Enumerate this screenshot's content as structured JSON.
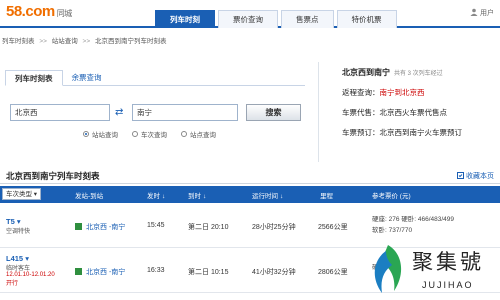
{
  "header": {
    "logo_text": "58.com",
    "logo_city": "同城",
    "nav_tabs": [
      {
        "label": "列车时刻",
        "active": true
      },
      {
        "label": "票价查询",
        "active": false
      },
      {
        "label": "售票点",
        "active": false
      },
      {
        "label": "特价机票",
        "active": false
      }
    ],
    "user_label": "用户"
  },
  "breadcrumb": [
    "列车时刻表",
    "站站查询",
    "北京西到南宁列车时刻表"
  ],
  "search": {
    "tabs": [
      "列车时刻表",
      "余票查询"
    ],
    "from_value": "北京西",
    "to_value": "南宁",
    "button_label": "搜索",
    "radios": [
      {
        "label": "站站查询",
        "checked": true
      },
      {
        "label": "车次查询",
        "checked": false
      },
      {
        "label": "站点查询",
        "checked": false
      }
    ]
  },
  "info": {
    "title": "北京西到南宁",
    "count_text": "共有 3 次列车经过",
    "rows": [
      {
        "label": "返程查询：",
        "value": "南宁到北京西",
        "red": true
      },
      {
        "label": "车票代售：",
        "value": "北京西火车票代售点",
        "red": false
      },
      {
        "label": "车票预订：",
        "value": "北京西到南宁火车票预订",
        "red": false
      }
    ]
  },
  "table": {
    "title": "北京西到南宁列车时刻表",
    "collect_label": "收藏本页",
    "headers": {
      "type": "车次类型",
      "station": "发站-到站",
      "depart": "发时",
      "arrive": "到时",
      "duration": "运行时间",
      "distance": "里程",
      "price": "参考票价 (元)"
    },
    "rows": [
      {
        "train": "T5",
        "sub": "空调特快",
        "date": "",
        "route": "北京西 -南宁",
        "depart": "15:45",
        "arrive": "第二日 20:10",
        "duration": "28小时25分钟",
        "distance": "2566公里",
        "price_line1": "硬座: 276  硬卧: 466/483/499",
        "price_line2": "软卧: 737/770"
      },
      {
        "train": "L415",
        "sub": "临时客车",
        "date": "12.01.10-12.01.20",
        "date2": "开行",
        "route": "北京西 -南宁",
        "depart": "16:33",
        "arrive": "第二日 10:15",
        "duration": "41小时32分钟",
        "distance": "2806公里",
        "price_line1": "硬座: 276",
        "price_line2": ""
      }
    ]
  },
  "watermark": {
    "title": "聚集號",
    "sub": "JUJIHAO"
  }
}
